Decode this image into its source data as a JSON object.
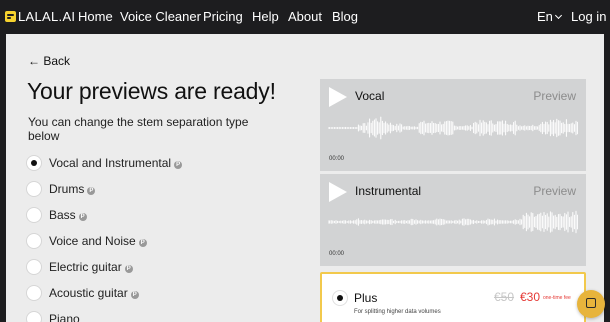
{
  "nav": {
    "logo": "LALAL.AI",
    "links": [
      "Home",
      "Voice Cleaner",
      "Pricing",
      "Help",
      "About",
      "Blog"
    ],
    "language": "En",
    "login": "Log in"
  },
  "page": {
    "back": "← Back",
    "title": "Your previews are ready!",
    "subtitle": "You can change the stem separation type below"
  },
  "options": [
    {
      "label": "Vocal and Instrumental",
      "badge": "P",
      "selected": true
    },
    {
      "label": "Drums",
      "badge": "P",
      "selected": false
    },
    {
      "label": "Bass",
      "badge": "P",
      "selected": false
    },
    {
      "label": "Voice and Noise",
      "badge": "P",
      "selected": false
    },
    {
      "label": "Electric guitar",
      "badge": "P",
      "selected": false
    },
    {
      "label": "Acoustic guitar",
      "badge": "P",
      "selected": false
    },
    {
      "label": "Piano",
      "badge": "",
      "selected": false
    }
  ],
  "previews": [
    {
      "name": "Vocal",
      "action": "Preview",
      "time": "00:00"
    },
    {
      "name": "Instrumental",
      "action": "Preview",
      "time": "00:00"
    }
  ],
  "plan": {
    "name": "Plus",
    "description": "For splitting higher data volumes",
    "old_price": "€50",
    "new_price": "€30",
    "note": "one-time fee"
  },
  "colors": {
    "nav_bg": "#1d1d1f",
    "accent": "#f6d22e",
    "sale": "#e53935",
    "plan_border": "#f2c94c"
  },
  "icons": {
    "play": "play-icon",
    "chat": "chat-icon",
    "lang_chevron": "chevron-down-icon"
  }
}
